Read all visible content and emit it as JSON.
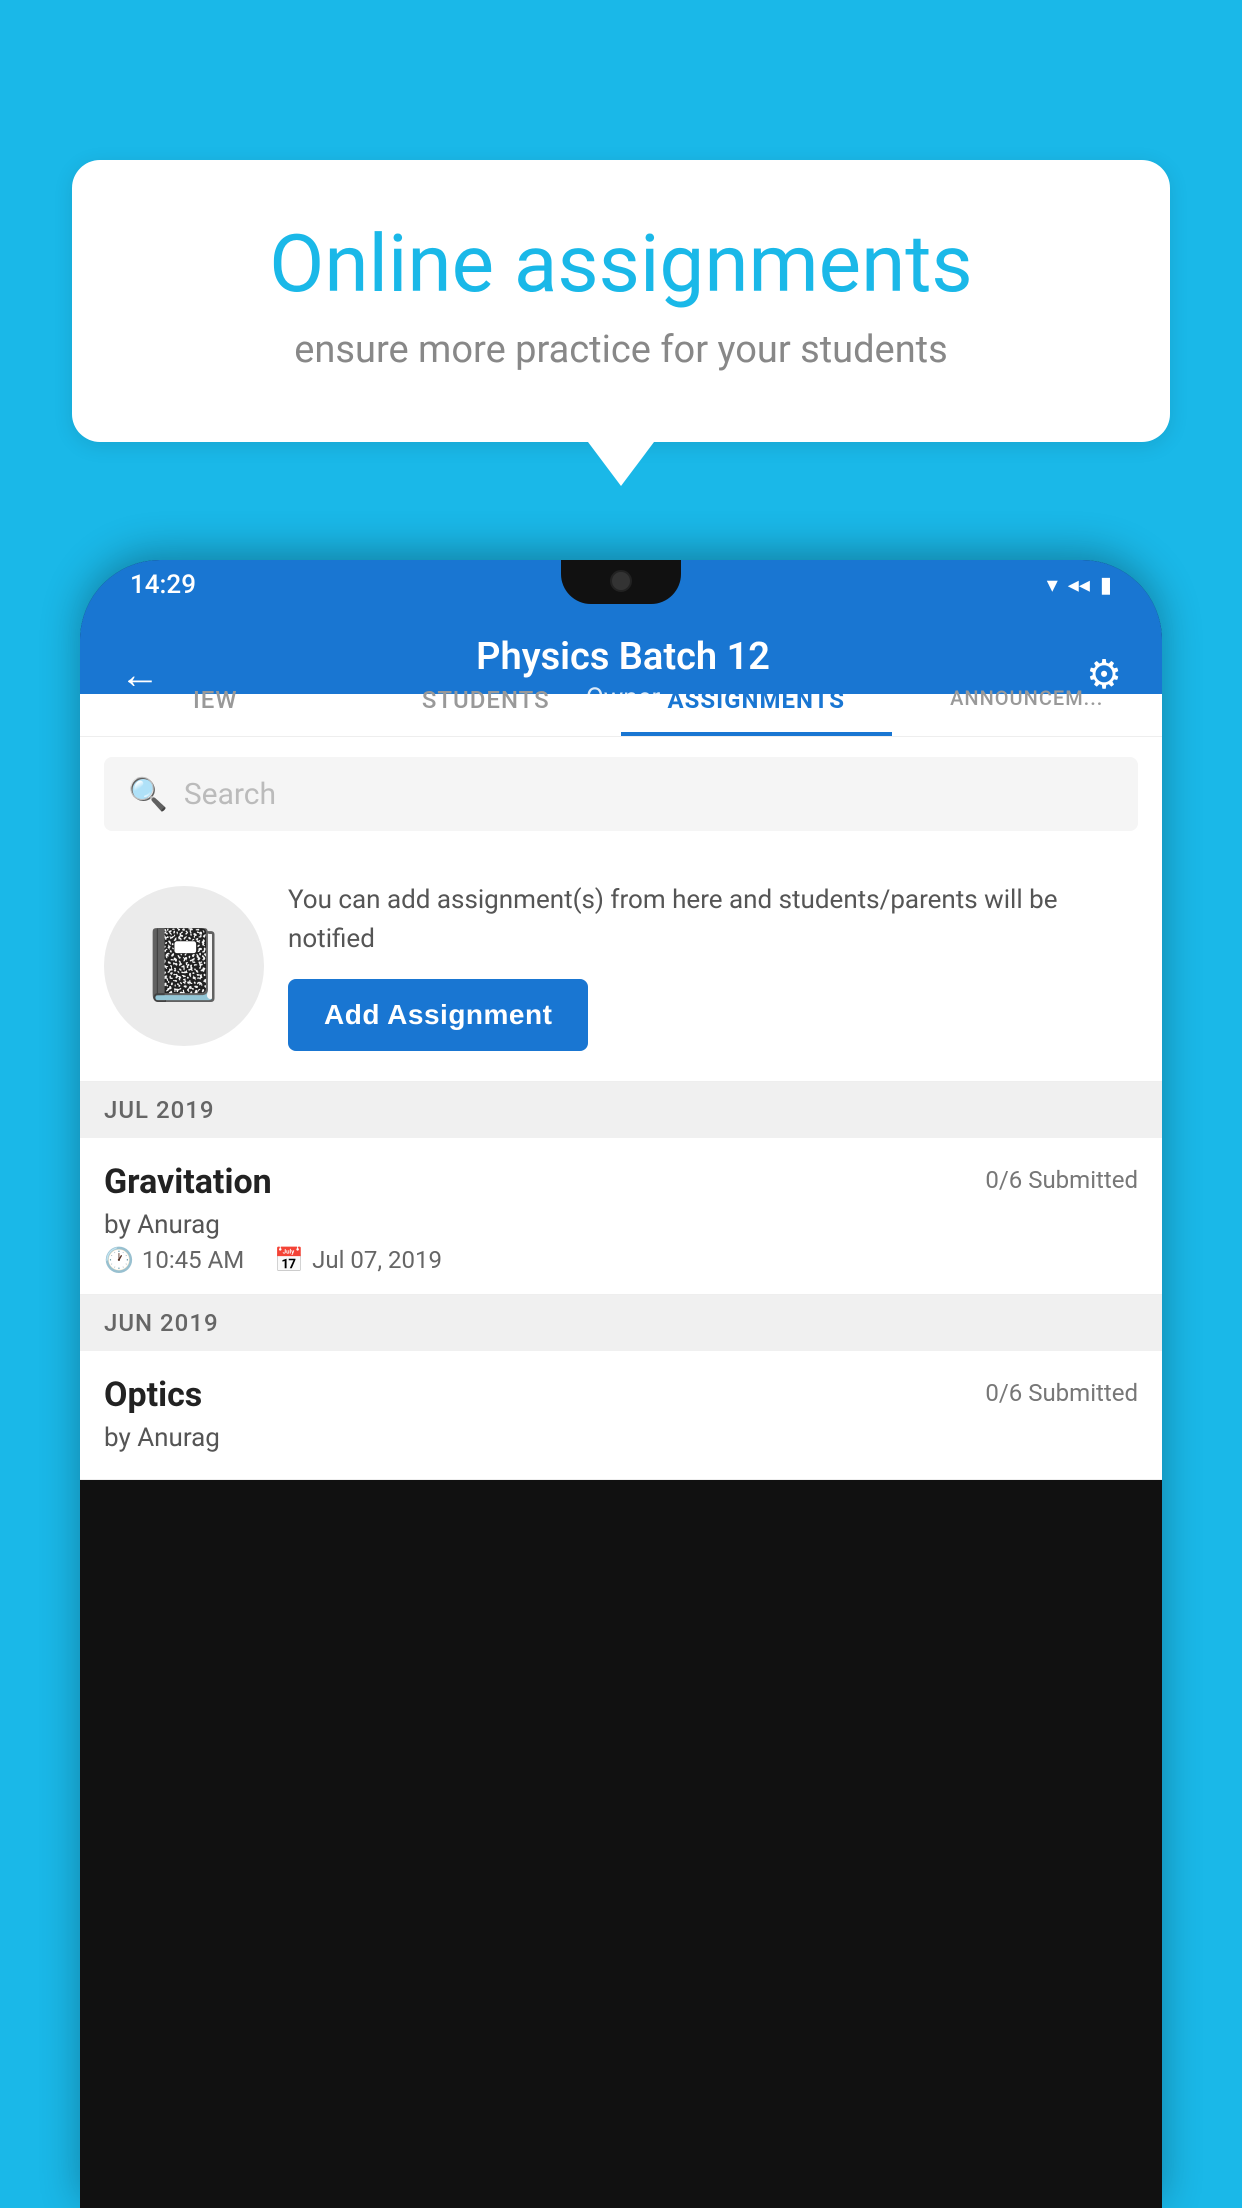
{
  "background_color": "#1AB8E8",
  "speech_bubble": {
    "title": "Online assignments",
    "subtitle": "ensure more practice for your students"
  },
  "phone": {
    "status_bar": {
      "time": "14:29",
      "wifi_icon": "▾",
      "signal_icon": "◂",
      "battery_icon": "▮"
    },
    "header": {
      "back_label": "←",
      "title": "Physics Batch 12",
      "subtitle": "Owner",
      "gear_label": "⚙"
    },
    "tabs": [
      {
        "label": "IEW",
        "active": false
      },
      {
        "label": "STUDENTS",
        "active": false
      },
      {
        "label": "ASSIGNMENTS",
        "active": true
      },
      {
        "label": "ANNOUNCEM...",
        "active": false
      }
    ],
    "search": {
      "placeholder": "Search"
    },
    "promo": {
      "description": "You can add assignment(s) from here and students/parents will be notified",
      "button_label": "Add Assignment"
    },
    "sections": [
      {
        "month": "JUL 2019",
        "assignments": [
          {
            "title": "Gravitation",
            "submitted": "0/6 Submitted",
            "author": "by Anurag",
            "time": "10:45 AM",
            "date": "Jul 07, 2019"
          }
        ]
      },
      {
        "month": "JUN 2019",
        "assignments": [
          {
            "title": "Optics",
            "submitted": "0/6 Submitted",
            "author": "by Anurag",
            "time": "",
            "date": ""
          }
        ]
      }
    ]
  }
}
